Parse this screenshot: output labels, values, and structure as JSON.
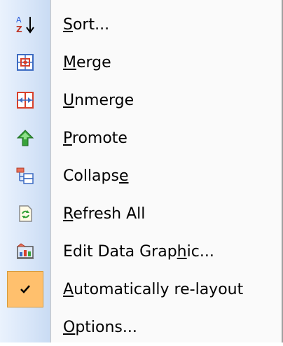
{
  "menu": {
    "items": [
      {
        "pre": "",
        "u": "S",
        "post": "ort...",
        "icon": "sort-az-icon"
      },
      {
        "pre": "",
        "u": "M",
        "post": "erge",
        "icon": "merge-icon"
      },
      {
        "pre": "",
        "u": "U",
        "post": "nmerge",
        "icon": "unmerge-icon"
      },
      {
        "pre": "",
        "u": "P",
        "post": "romote",
        "icon": "promote-arrow-icon"
      },
      {
        "pre": "Collaps",
        "u": "e",
        "post": "",
        "icon": "collapse-icon"
      },
      {
        "pre": "",
        "u": "R",
        "post": "efresh All",
        "icon": "refresh-icon"
      },
      {
        "pre": "Edit Data Grap",
        "u": "h",
        "post": "ic...",
        "icon": "data-graphic-icon"
      },
      {
        "pre": "",
        "u": "A",
        "post": "utomatically re-layout",
        "icon": "checkmark-icon",
        "checked": true
      },
      {
        "pre": "",
        "u": "O",
        "post": "ptions...",
        "icon": ""
      }
    ]
  },
  "colors": {
    "gutter": "#d7e5f8",
    "checked_highlight": "#ffc06d",
    "icon_red": "#d8402a",
    "icon_green": "#37a23a"
  }
}
